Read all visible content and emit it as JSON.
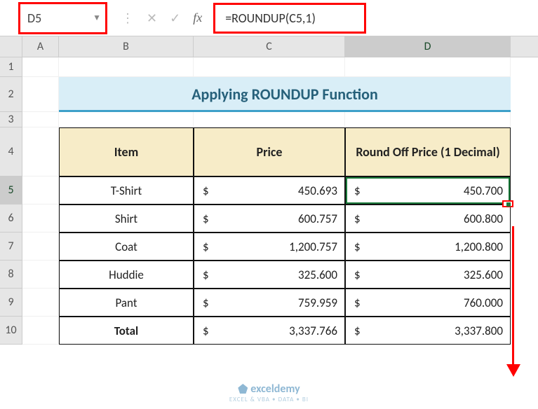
{
  "namebox": "D5",
  "formula": "=ROUNDUP(C5,1)",
  "fx_label": "fx",
  "columns": {
    "A": "A",
    "B": "B",
    "C": "C",
    "D": "D"
  },
  "rows": [
    "1",
    "2",
    "3",
    "4",
    "5",
    "6",
    "7",
    "8",
    "9",
    "10"
  ],
  "title": "Applying ROUNDUP Function",
  "headers": {
    "item": "Item",
    "price": "Price",
    "round": "Round Off Price (1 Decimal)"
  },
  "currency": "$",
  "data": [
    {
      "item": "T-Shirt",
      "price": "450.693",
      "round": "450.700"
    },
    {
      "item": "Shirt",
      "price": "600.757",
      "round": "600.800"
    },
    {
      "item": "Coat",
      "price": "1,200.757",
      "round": "1,200.800"
    },
    {
      "item": "Huddie",
      "price": "325.600",
      "round": "325.600"
    },
    {
      "item": "Pant",
      "price": "759.959",
      "round": "760.000"
    }
  ],
  "total": {
    "label": "Total",
    "price": "3,337.766",
    "round": "3,337.800"
  },
  "watermark": {
    "brand": "exceldemy",
    "sub": "EXCEL & VBA • DATA • BI"
  },
  "chart_data": {
    "type": "table",
    "title": "Applying ROUNDUP Function",
    "columns": [
      "Item",
      "Price",
      "Round Off Price (1 Decimal)"
    ],
    "rows": [
      [
        "T-Shirt",
        450.693,
        450.7
      ],
      [
        "Shirt",
        600.757,
        600.8
      ],
      [
        "Coat",
        1200.757,
        1200.8
      ],
      [
        "Huddie",
        325.6,
        325.6
      ],
      [
        "Pant",
        759.959,
        760.0
      ],
      [
        "Total",
        3337.766,
        3337.8
      ]
    ]
  }
}
